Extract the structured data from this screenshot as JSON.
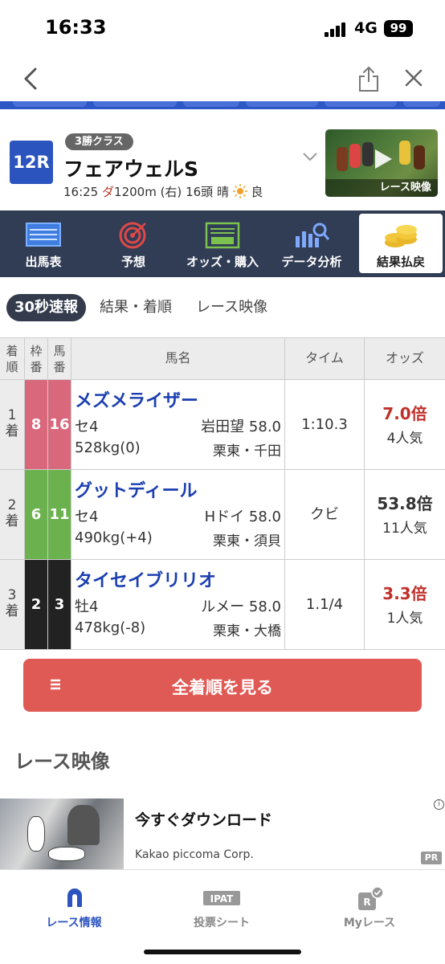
{
  "status_bar": {
    "time": "16:33",
    "network": "4G",
    "battery": "99"
  },
  "race": {
    "number": "12R",
    "class": "3勝クラス",
    "name": "フェアウェルS",
    "time": "16:25",
    "surface": "ダ",
    "distance": "1200m (右)",
    "runners": "16頭",
    "weather": "晴",
    "track": "良",
    "video_label": "レース映像"
  },
  "menu": [
    {
      "label": "出馬表",
      "icon": "entry-table-icon"
    },
    {
      "label": "予想",
      "icon": "target-icon"
    },
    {
      "label": "オッズ・購入",
      "icon": "ipat-icon"
    },
    {
      "label": "データ分析",
      "icon": "chart-search-icon"
    },
    {
      "label": "結果払戻",
      "icon": "coins-icon"
    }
  ],
  "tabs": [
    {
      "label": "30秒速報",
      "active": true
    },
    {
      "label": "結果・着順",
      "active": false
    },
    {
      "label": "レース映像",
      "active": false
    }
  ],
  "table": {
    "headers": {
      "position": [
        "着",
        "順"
      ],
      "waku": [
        "枠",
        "番"
      ],
      "uma": [
        "馬",
        "番"
      ],
      "horse": "馬名",
      "time": "タイム",
      "odds": "オッズ"
    },
    "rows": [
      {
        "pos_num": "1",
        "pos_suffix": "着",
        "waku": "8",
        "uma": "16",
        "name": "メズメライザー",
        "sex_age": "セ4",
        "jockey": "岩田望 58.0",
        "weight": "528kg(0)",
        "trainer": "栗東・千田",
        "time": "1:10.3",
        "odds": "7.0倍",
        "popularity": "4人気",
        "waku_color": "#d9687c",
        "odds_color": "#c0302b"
      },
      {
        "pos_num": "2",
        "pos_suffix": "着",
        "waku": "6",
        "uma": "11",
        "name": "グットディール",
        "sex_age": "セ4",
        "jockey": "Hドイ 58.0",
        "weight": "490kg(+4)",
        "trainer": "栗東・須貝",
        "time": "クビ",
        "odds": "53.8倍",
        "popularity": "11人気",
        "waku_color": "#6bb24f",
        "odds_color": "#333333"
      },
      {
        "pos_num": "3",
        "pos_suffix": "着",
        "waku": "2",
        "uma": "3",
        "name": "タイセイブリリオ",
        "sex_age": "牡4",
        "jockey": "ルメー 58.0",
        "weight": "478kg(-8)",
        "trainer": "栗東・大橋",
        "time": "1.1/4",
        "odds": "3.3倍",
        "popularity": "1人気",
        "waku_color": "#222222",
        "odds_color": "#c0302b"
      }
    ]
  },
  "all_results_button": "全着順を見る",
  "section_title": "レース映像",
  "ad": {
    "title": "今すぐダウンロード",
    "company": "Kakao piccoma Corp.",
    "pr_badge": "PR",
    "info_icon": "i"
  },
  "tab_bar": [
    {
      "label": "レース情報",
      "icon": "horseshoe-icon",
      "active": true
    },
    {
      "label": "投票シート",
      "icon": "ipat-icon",
      "active": false
    },
    {
      "label": "Myレース",
      "icon": "my-race-icon",
      "active": false
    }
  ],
  "colors": {
    "brand_blue": "#2b54be",
    "menu_bg": "#313d55",
    "button_red": "#e05a55",
    "horse_name": "#1b3fb0"
  }
}
